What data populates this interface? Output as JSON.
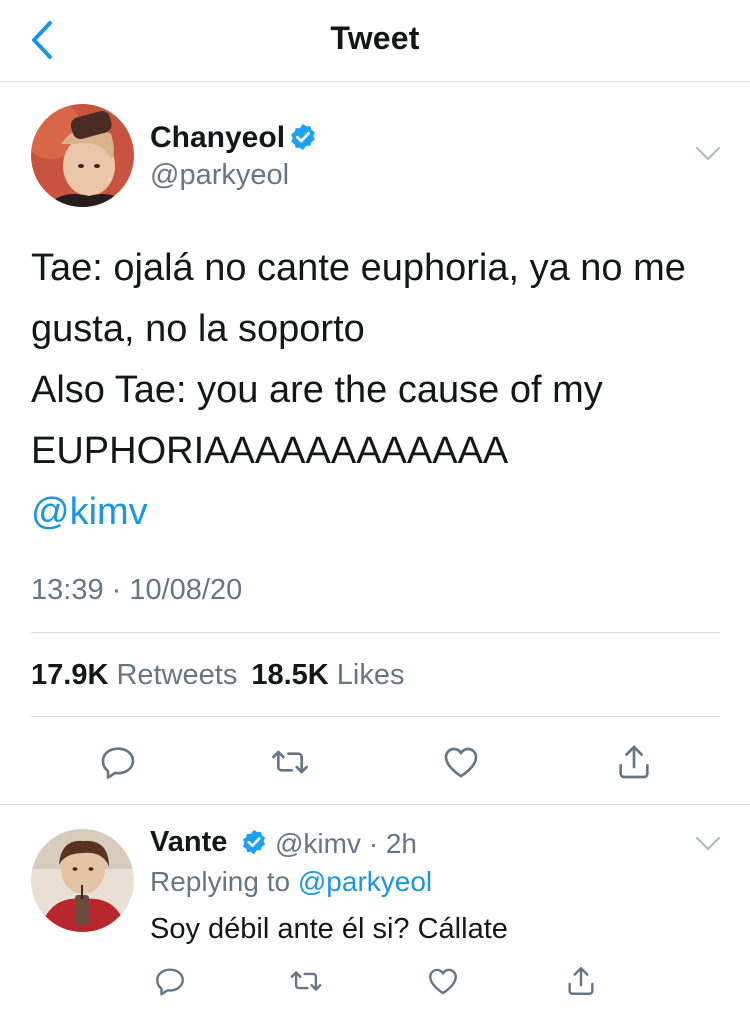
{
  "header": {
    "title": "Tweet",
    "back_icon": "chevron-left-icon"
  },
  "colors": {
    "link": "#1b95e0",
    "muted": "#657786",
    "text": "#14171a",
    "divider": "#d8dde2"
  },
  "tweet": {
    "author": {
      "name": "Chanyeol",
      "handle": "@parkyeol",
      "verified": true
    },
    "text_lines": [
      "Tae: ojalá no cante euphoria, ya no me",
      "gusta, no la soporto",
      "Also Tae: you are the cause of my",
      "EUPHORIAAAAAAAAAAAA"
    ],
    "mention": "@kimv",
    "timestamp": "13:39 · 10/08/20",
    "stats": {
      "retweets_count": "17.9K",
      "retweets_label": "Retweets",
      "likes_count": "18.5K",
      "likes_label": "Likes"
    },
    "actions": [
      "reply-icon",
      "retweet-icon",
      "like-icon",
      "share-icon"
    ]
  },
  "reply": {
    "author": {
      "name": "Vante",
      "handle": "@kimv",
      "verified": true
    },
    "meta": "@kimv · 2h",
    "replying_prefix": "Replying to",
    "replying_to": "@parkyeol",
    "text": "Soy débil ante él si? Cállate",
    "actions": [
      "reply-icon",
      "retweet-icon",
      "like-icon",
      "share-icon"
    ]
  }
}
